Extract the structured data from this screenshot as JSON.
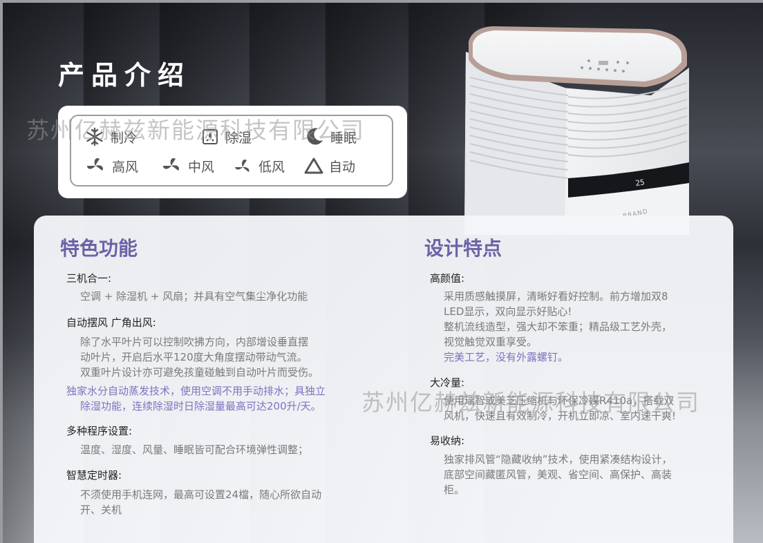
{
  "header": {
    "title": "产品介绍"
  },
  "watermark": "苏州亿赫兹新能源科技有限公司",
  "product": {
    "display_value": "25",
    "brand": "BRAND"
  },
  "modes": [
    {
      "icon": "snowflake-icon",
      "label": "制冷"
    },
    {
      "icon": "dehumidify-icon",
      "label": "除湿"
    },
    {
      "icon": "moon-sleep-icon",
      "label": "睡眠"
    },
    {
      "icon": "fan-high-icon",
      "label": "高风"
    },
    {
      "icon": "fan-medium-icon",
      "label": "中风"
    },
    {
      "icon": "fan-low-icon",
      "label": "低风"
    },
    {
      "icon": "auto-triangle-icon",
      "label": "自动"
    }
  ],
  "features": {
    "title": "特色功能",
    "items": [
      {
        "title": "三机合一:",
        "lines": [
          "空调 + 除湿机 + 风扇；并具有空气集尘净化功能"
        ]
      },
      {
        "title": "自动摆风 广角出风:",
        "lines": [
          "除了水平叶片可以控制吹拂方向，内部增设垂直摆",
          "动叶片，开启后水平120度大角度摆动带动气流。",
          "双重叶片设计亦可避免孩童碰触到自动叶片而受伤。"
        ],
        "highlight": [
          "独家水分自动蒸发技术，使用空调不用手动排水；具独立",
          "除湿功能，连续除湿时日除湿量最高可达200升/天。"
        ]
      },
      {
        "title": "多种程序设置:",
        "lines": [
          "温度、湿度、风量、睡眠皆可配合环境弹性调整；"
        ]
      },
      {
        "title": "智慧定时器:",
        "lines": [
          "不须使用手机连网，最高可设置24檔，随心所欲自动",
          "开、关机"
        ]
      }
    ]
  },
  "design": {
    "title": "设计特点",
    "items": [
      {
        "title": "高颜值:",
        "lines": [
          "采用质感触摸屏，清晰好看好控制。前方增加双8",
          "LED显示，双向显示好贴心!",
          "整机流线造型，强大却不笨重；精品级工艺外壳，",
          "视觉触觉双重享受。"
        ],
        "highlight": [
          "完美工艺，没有外露螺钉。"
        ]
      },
      {
        "title": "大冷量:",
        "lines": [
          "使用瑞智或美芝压缩机与环保冷媒R410a，搭载双",
          "风机，快速且有效制冷，开机立即凉、室内速干爽!"
        ]
      },
      {
        "title": "易收纳:",
        "lines": [
          "独家排风管“隐藏收纳”技术，使用紧凑结构设计，",
          "底部空间藏匿风管，美观、省空间、高保护、高装",
          "柜。"
        ]
      }
    ]
  }
}
